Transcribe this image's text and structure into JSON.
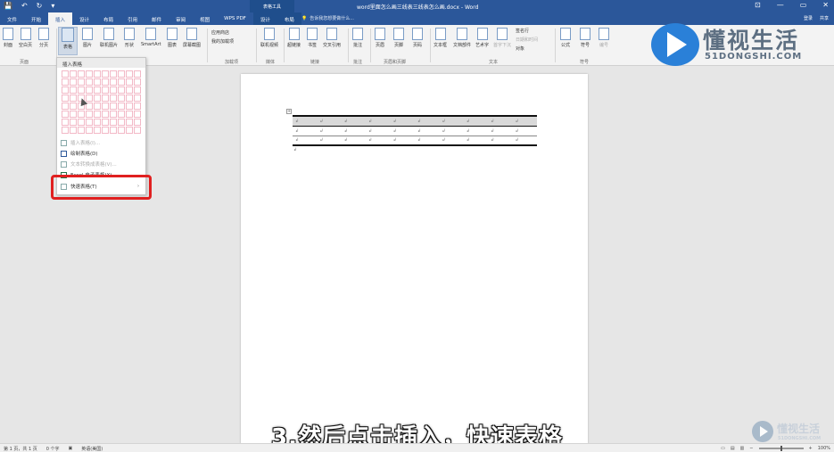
{
  "window": {
    "title": "word里面怎么画三线表三线表怎么画.docx - Word",
    "context_tool": "表格工具",
    "controls": [
      "⊡",
      "—",
      "▭",
      "✕"
    ]
  },
  "qat": [
    "💾",
    "↶",
    "↻",
    "▾"
  ],
  "tabs": [
    {
      "label": "文件"
    },
    {
      "label": "开始"
    },
    {
      "label": "插入"
    },
    {
      "label": "设计"
    },
    {
      "label": "布局"
    },
    {
      "label": "引用"
    },
    {
      "label": "邮件"
    },
    {
      "label": "审阅"
    },
    {
      "label": "视图"
    },
    {
      "label": "WPS PDF"
    },
    {
      "label": "设计"
    },
    {
      "label": "布局"
    }
  ],
  "tellme": "告诉我您想要做什么...",
  "user": {
    "login": "登录",
    "share": "共享"
  },
  "ribbon": {
    "buttons": {
      "cover": "封面",
      "blank": "空白页",
      "pagebreak": "分页",
      "table": "表格",
      "picture": "图片",
      "online_pic": "联机图片",
      "shapes": "形状",
      "smartart": "SmartArt",
      "chart": "图表",
      "screenshot": "屏幕截图",
      "store": "应用商店",
      "my_addins": "我的加载项",
      "online_video": "联机视频",
      "link": "超链接",
      "bookmark": "书签",
      "crossref": "交叉引用",
      "comment": "批注",
      "header": "页眉",
      "footer": "页脚",
      "page_number": "页码",
      "textbox": "文本框",
      "docparts": "文档部件",
      "wordart": "艺术字",
      "dropcap": "首字下沉",
      "signature": "签名行",
      "datetime": "日期和时间",
      "object": "对象",
      "equation": "公式",
      "symbol": "符号",
      "number": "编号"
    },
    "groups": {
      "pages": "页面",
      "addins": "加载项",
      "media": "媒体",
      "links": "链接",
      "comments": "批注",
      "header_footer": "页眉和页脚",
      "text": "文本",
      "symbols": "符号"
    }
  },
  "logo": {
    "cn": "懂视生活",
    "en": "51DONGSHI.COM"
  },
  "menu": {
    "header": "插入表格",
    "items": {
      "insert_table": "插入表格(I)...",
      "draw_table": "绘制表格(D)",
      "text_to_table": "文本转换成表格(V)...",
      "excel": "Excel 电子表格(X)",
      "quick_tables": "快速表格(T)"
    }
  },
  "table_mark": "↲",
  "caption": "3.然后点击插入，快速表格",
  "watermark": {
    "cn": "懂视生活",
    "en": "51DONGSHI.COM"
  },
  "status": {
    "page": "第 1 页，共 1 页",
    "words": "0 个字",
    "lang": "英语(美国)",
    "zoom": "100%"
  }
}
